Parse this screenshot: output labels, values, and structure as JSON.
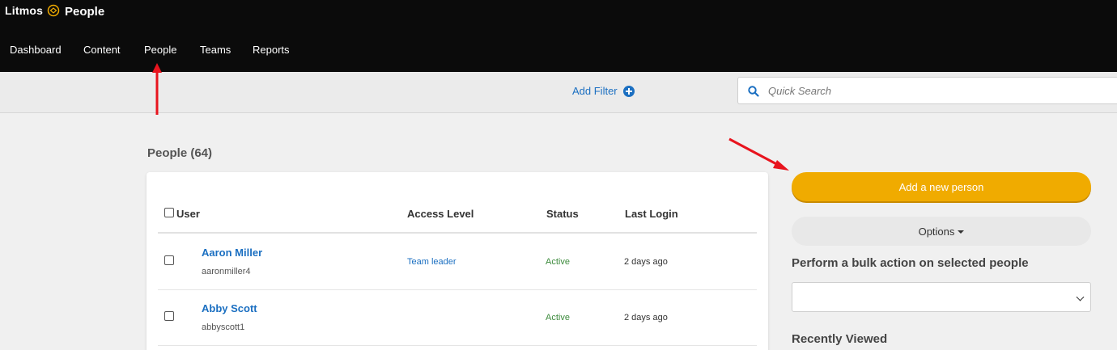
{
  "brand": {
    "name": "Litmos",
    "app_title": "People"
  },
  "nav": {
    "items": [
      {
        "label": "Dashboard"
      },
      {
        "label": "Content"
      },
      {
        "label": "People"
      },
      {
        "label": "Teams"
      },
      {
        "label": "Reports"
      }
    ]
  },
  "filter": {
    "add_filter_label": "Add Filter",
    "search_placeholder": "Quick Search"
  },
  "main": {
    "title": "People (64)",
    "table": {
      "columns": [
        "User",
        "Access Level",
        "Status",
        "Last Login"
      ],
      "rows": [
        {
          "name": "Aaron Miller",
          "username": "aaronmiller4",
          "access_level": "Team leader",
          "status": "Active",
          "last_login": "2 days ago"
        },
        {
          "name": "Abby Scott",
          "username": "abbyscott1",
          "access_level": "",
          "status": "Active",
          "last_login": "2 days ago"
        }
      ]
    }
  },
  "sidebar": {
    "add_person_label": "Add a new person",
    "options_label": "Options",
    "bulk_action_title": "Perform a bulk action on selected people",
    "recently_viewed_title": "Recently Viewed"
  },
  "colors": {
    "topbar": "#0b0b0b",
    "accent_blue": "#1b6fc1",
    "primary_button": "#f0ab00",
    "status_active": "#3d8b3d",
    "annotation_arrow": "#e8141e"
  }
}
